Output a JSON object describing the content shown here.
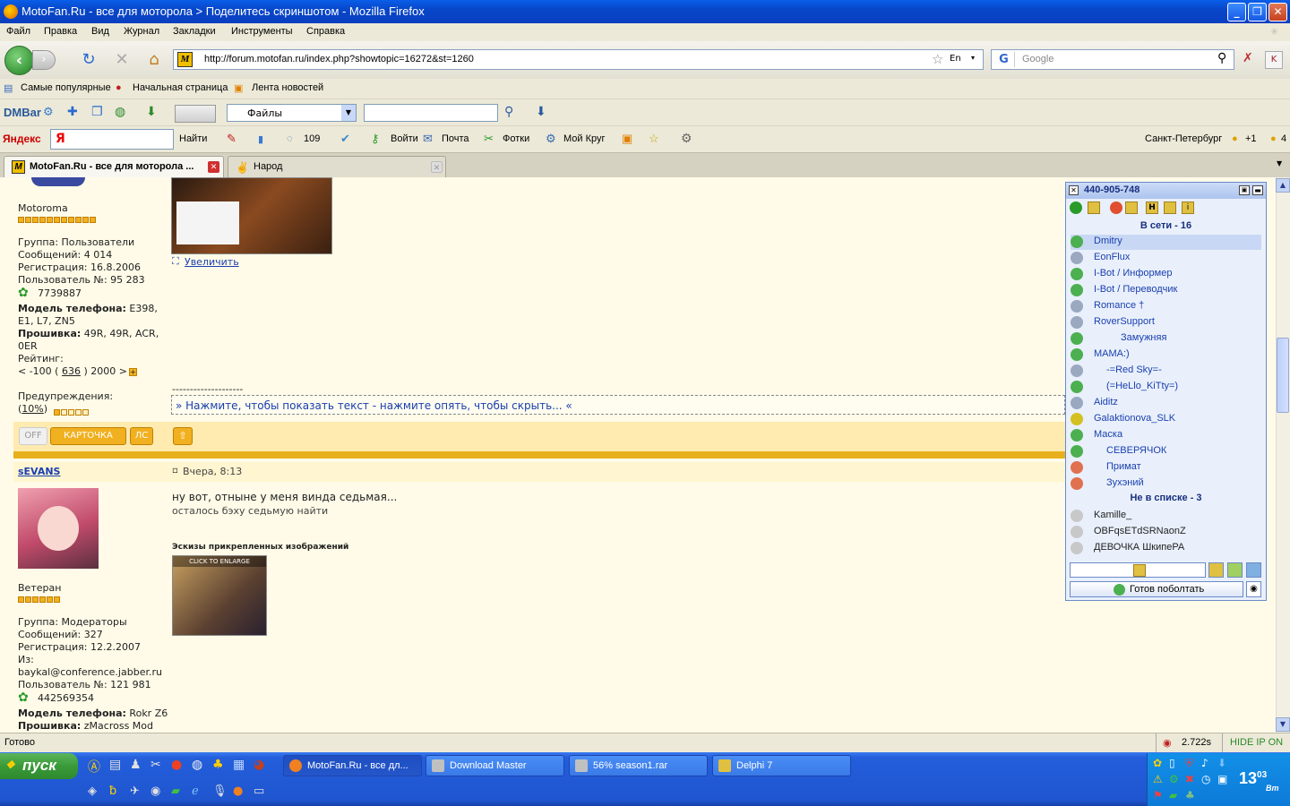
{
  "window": {
    "title": "MotoFan.Ru - все для моторола > Поделитесь скриншотом - Mozilla Firefox"
  },
  "menu": [
    "Файл",
    "Правка",
    "Вид",
    "Журнал",
    "Закладки",
    "Инструменты",
    "Справка"
  ],
  "nav": {
    "url": "http://forum.motofan.ru/index.php?showtopic=16272&st=1260",
    "search_placeholder": "Google",
    "lang_badge": "En"
  },
  "bookmarks": [
    "Самые популярные",
    "Начальная страница",
    "Лента новостей"
  ],
  "dmbar": {
    "logo": "DMBar",
    "category": "Файлы"
  },
  "yandexbar": {
    "logo": "Яндекс",
    "search_button": "Найти",
    "count": "109",
    "login": "Войти",
    "mail": "Почта",
    "photos": "Фотки",
    "circle": "Мой Круг",
    "city": "Санкт-Петербург",
    "weather_delta": "+1",
    "traffic": "4"
  },
  "tabs": [
    {
      "label": "MotoFan.Ru - все для моторола ...",
      "active": true
    },
    {
      "label": "Народ",
      "active": false
    }
  ],
  "post1": {
    "author_rank": "Motoroma",
    "group": "Группа: Пользователи",
    "messages": "Сообщений: 4 014",
    "registered": "Регистрация: 16.8.2006",
    "user_no": "Пользователь №: 95 283",
    "icq": "7739887",
    "phone_label": "Модель телефона:",
    "phone_value": " E398,",
    "phone_value2": "E1, L7, ZN5",
    "firmware_label": "Прошивка:",
    "firmware_value": " 49R, 49R, ACR,",
    "firmware_value2": "0ER",
    "rating_label": "Рейтинг:",
    "rating_pre": "< -100 ( ",
    "rating_value": "636",
    "rating_post": " ) 2000 >",
    "warnings_label": "Предупреждения:",
    "warnings_open": "(",
    "warnings_value": "10%",
    "warnings_close": ")",
    "enlarge": "Увеличить",
    "divider": "--------------------",
    "spoiler": "» Нажмите, чтобы показать текст - нажмите опять, чтобы скрыть... «",
    "btn_off": "OFF",
    "btn_card": "КАРТОЧКА",
    "btn_pm": "ЛС"
  },
  "post2": {
    "author": "sEVANS",
    "date": "Вчера, 8:13",
    "rank": "Ветеран",
    "group": "Группа: Модераторы",
    "messages": "Сообщений: 327",
    "registered": "Регистрация: 12.2.2007",
    "from_label": "Из:",
    "from_value": "baykal@conference.jabber.ru",
    "user_no": "Пользователь №: 121 981",
    "icq": "442569354",
    "phone_label": "Модель телефона:",
    "phone_value": " Rokr Z6",
    "firmware_label": "Прошивка:",
    "firmware_value": " zMacross Mod",
    "text1": "ну вот, отныне у меня винда седьмая...",
    "text2": "осталось бэху седьмую найти",
    "attachments_label": "Эскизы прикрепленных изображений",
    "thumb_caption": "CLICK TO ENLARGE"
  },
  "icq": {
    "uin": "440-905-748",
    "online_header": "В сети - 16",
    "offline_header": "Не в списке - 3",
    "online": [
      {
        "name": "Dmitry",
        "color": "#4caf50"
      },
      {
        "name": "EonFlux",
        "color": "#9aa8c0"
      },
      {
        "name": "I-Bot / Информер",
        "color": "#4caf50"
      },
      {
        "name": "I-Bot / Переводчик",
        "color": "#4caf50"
      },
      {
        "name": "Romance †",
        "color": "#9aa8c0"
      },
      {
        "name": "RoverSupport",
        "color": "#9aa8c0"
      },
      {
        "name": "Замужняя",
        "color": "#4caf50"
      },
      {
        "name": "MAMA:)",
        "color": "#4caf50"
      },
      {
        "name": "-=Red Sky=-",
        "color": "#9aa8c0"
      },
      {
        "name": "(=HeLlo_KiTty=)",
        "color": "#4caf50"
      },
      {
        "name": "Aiditz",
        "color": "#9aa8c0"
      },
      {
        "name": "Galaktionova_SLK",
        "color": "#d4c020"
      },
      {
        "name": "Маска",
        "color": "#4caf50"
      },
      {
        "name": "СЕВЕРЯЧОК",
        "color": "#4caf50"
      },
      {
        "name": "Примат",
        "color": "#e07050"
      },
      {
        "name": "Зухэний",
        "color": "#e07050"
      }
    ],
    "offline": [
      "Kamille_",
      "OBFqsETdSRNaonZ",
      "ДЕВОЧКА ШкипеРА"
    ],
    "status_button": "Готов поболтать"
  },
  "status": {
    "text": "Готово",
    "time": "2.722s",
    "hide_ip": "HIDE IP ON"
  },
  "taskbar": {
    "start": "пуск",
    "buttons": [
      {
        "label": "MotoFan.Ru - все дл...",
        "active": true
      },
      {
        "label": "Download Master",
        "active": false
      },
      {
        "label": "56% season1.rar",
        "active": false
      },
      {
        "label": "Delphi 7",
        "active": false
      }
    ],
    "clock": "13",
    "clock_min": "03",
    "clock_day": "Вт"
  },
  "colors": {
    "titlebar": "#0a5ee8",
    "forum_bg": "#fffbe8",
    "post_bar": "#e8b01c",
    "icq_bg": "#e9f0fb",
    "taskbar": "#245edb"
  }
}
